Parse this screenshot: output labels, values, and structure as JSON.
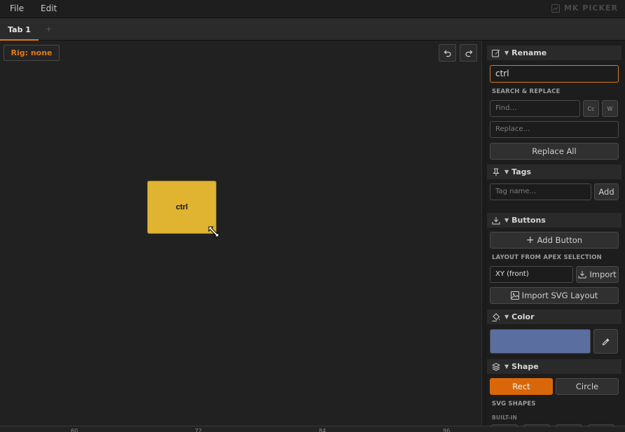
{
  "menubar": {
    "items": [
      "File",
      "Edit"
    ],
    "brand": "MK PICKER"
  },
  "tabs": [
    {
      "label": "Tab 1",
      "active": true
    }
  ],
  "tab_add": "+",
  "canvas": {
    "rig_label": "Rig: none",
    "control": {
      "label": "ctrl",
      "color": "#e0b331"
    },
    "undo_icon": "undo-icon",
    "redo_icon": "redo-icon"
  },
  "ruler": {
    "ticks": [
      "60",
      "72",
      "84",
      "96"
    ]
  },
  "panel": {
    "rename": {
      "title": "Rename",
      "value": "ctrl"
    },
    "search_replace": {
      "label": "SEARCH & REPLACE",
      "find_placeholder": "Find…",
      "case_label": "Cc",
      "word_label": "W",
      "replace_placeholder": "Replace…",
      "replace_all_label": "Replace All"
    },
    "tags": {
      "title": "Tags",
      "placeholder": "Tag name…",
      "add_label": "Add"
    },
    "buttons": {
      "title": "Buttons",
      "add_button_label": "Add Button",
      "layout_label": "LAYOUT FROM APEX SELECTION",
      "plane_value": "XY  (front)",
      "import_label": "Import",
      "import_svg_label": "Import SVG Layout"
    },
    "color": {
      "title": "Color",
      "swatch": "#5a6ea0"
    },
    "shape": {
      "title": "Shape",
      "rect_label": "Rect",
      "circle_label": "Circle",
      "svg_shapes_label": "SVG SHAPES",
      "builtin_label": "BUILT-IN"
    }
  },
  "accent_color": "#e07a10"
}
